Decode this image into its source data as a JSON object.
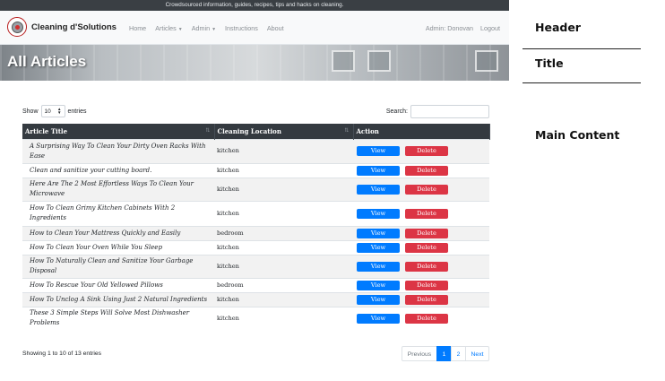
{
  "site": {
    "tagline": "Crowdsourced information, guides, recipes, tips and hacks on cleaning.",
    "brand": "Cleaning d'Solutions"
  },
  "nav": {
    "home": "Home",
    "articles": "Articles",
    "admin": "Admin",
    "instructions": "Instructions",
    "about": "About",
    "user": "Admin: Donovan",
    "logout": "Logout"
  },
  "hero": {
    "title": "All Articles"
  },
  "controls": {
    "show": "Show",
    "entries_value": "10",
    "entries": "entries",
    "search_label": "Search:",
    "search_value": ""
  },
  "table": {
    "headers": {
      "title": "Article Title",
      "location": "Cleaning Location",
      "action": "Action"
    },
    "view_label": "View",
    "delete_label": "Delete",
    "rows": [
      {
        "title": "A Surprising Way To Clean Your Dirty Oven Racks With Ease",
        "location": "kitchen"
      },
      {
        "title": "Clean and sanitize your cutting board.",
        "location": "kitchen"
      },
      {
        "title": "Here Are The 2 Most Effortless Ways To Clean Your Microwave",
        "location": "kitchen"
      },
      {
        "title": "How To Clean Grimy Kitchen Cabinets With 2 Ingredients",
        "location": "kitchen"
      },
      {
        "title": "How to Clean Your Mattress Quickly and Easily",
        "location": "bedroom"
      },
      {
        "title": "How To Clean Your Oven While You Sleep",
        "location": "kitchen"
      },
      {
        "title": "How To Naturally Clean and Sanitize Your Garbage Disposal",
        "location": "kitchen"
      },
      {
        "title": "How To Rescue Your Old Yellowed Pillows",
        "location": "bedroom"
      },
      {
        "title": "How To Unclog A Sink Using Just 2 Natural Ingredients",
        "location": "kitchen"
      },
      {
        "title": "These 3 Simple Steps Will Solve Most Dishwasher Problems",
        "location": "kitchen"
      }
    ]
  },
  "footer": {
    "info": "Showing 1 to 10 of 13 entries",
    "previous": "Previous",
    "page1": "1",
    "page2": "2",
    "next": "Next"
  },
  "annotations": {
    "header": "Header",
    "title": "Title",
    "main": "Main Content"
  },
  "colors": {
    "topbar": "#3a3f44",
    "table_header": "#343a40",
    "view_button": "#007bff",
    "delete_button": "#dc3545",
    "active_page": "#007bff"
  }
}
